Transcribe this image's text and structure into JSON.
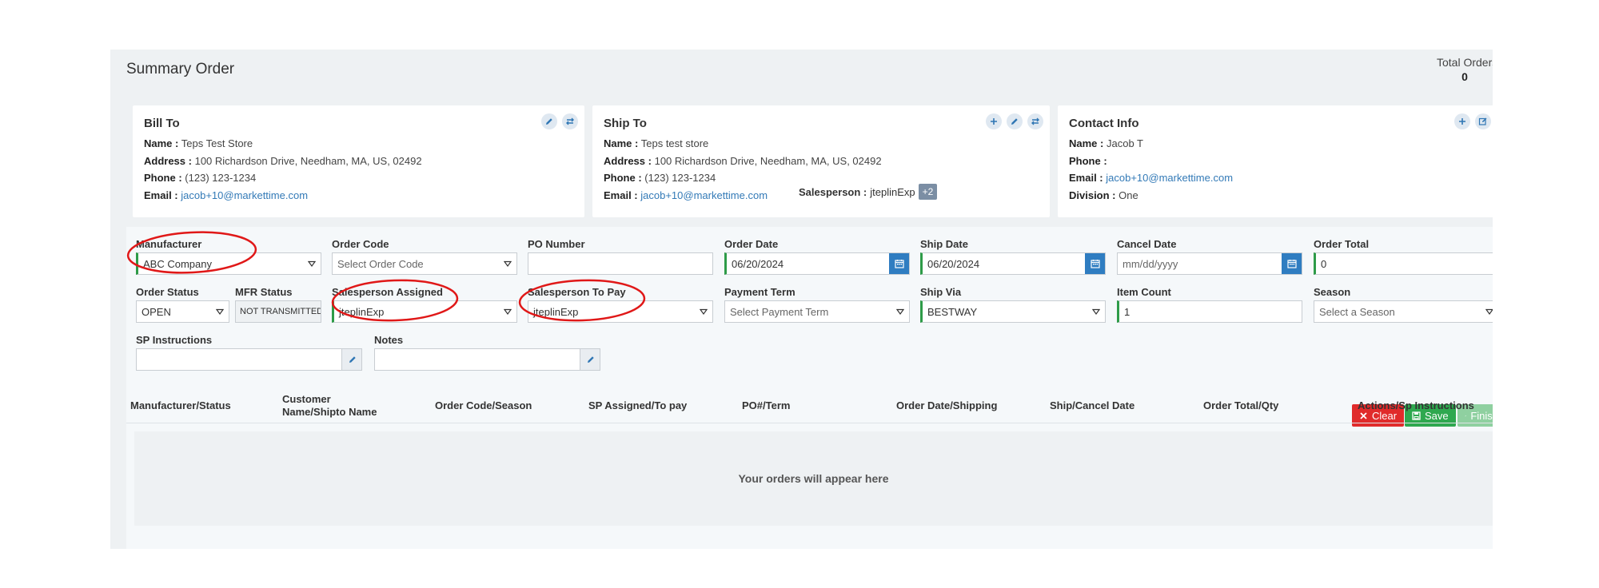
{
  "page": {
    "title": "Summary Order"
  },
  "total_orders": {
    "label": "Total Orders",
    "value": "0"
  },
  "bill_to": {
    "heading": "Bill To",
    "name_label": "Name :",
    "name": "Teps Test Store",
    "address_label": "Address :",
    "address": "100 Richardson Drive, Needham, MA, US, 02492",
    "phone_label": "Phone :",
    "phone": "(123) 123-1234",
    "email_label": "Email :",
    "email": "jacob+10@markettime.com"
  },
  "ship_to": {
    "heading": "Ship To",
    "name_label": "Name :",
    "name": "Teps test store",
    "address_label": "Address :",
    "address": "100 Richardson Drive, Needham, MA, US, 02492",
    "phone_label": "Phone :",
    "phone": "(123) 123-1234",
    "email_label": "Email :",
    "email": "jacob+10@markettime.com",
    "salesperson_label": "Salesperson :",
    "salesperson": "jteplinExp",
    "extra_badge": "+2"
  },
  "contact_info": {
    "heading": "Contact Info",
    "name_label": "Name :",
    "name": "Jacob T",
    "phone_label": "Phone :",
    "phone": "",
    "email_label": "Email :",
    "email": "jacob+10@markettime.com",
    "division_label": "Division :",
    "division": "One"
  },
  "form": {
    "manufacturer": {
      "label": "Manufacturer",
      "value": "ABC Company"
    },
    "order_code": {
      "label": "Order Code",
      "placeholder": "Select Order Code"
    },
    "po_number": {
      "label": "PO Number",
      "value": ""
    },
    "order_date": {
      "label": "Order Date",
      "value": "06/20/2024"
    },
    "ship_date": {
      "label": "Ship Date",
      "value": "06/20/2024"
    },
    "cancel_date": {
      "label": "Cancel Date",
      "placeholder": "mm/dd/yyyy"
    },
    "order_total": {
      "label": "Order Total",
      "value": "0"
    },
    "order_status": {
      "label": "Order Status",
      "value": "OPEN"
    },
    "mfr_status": {
      "label": "MFR Status",
      "value": "NOT TRANSMITTED"
    },
    "salesperson_assigned": {
      "label": "Salesperson Assigned",
      "value": "jteplinExp"
    },
    "salesperson_to_pay": {
      "label": "Salesperson To Pay",
      "value": "jteplinExp"
    },
    "payment_term": {
      "label": "Payment Term",
      "placeholder": "Select Payment Term"
    },
    "ship_via": {
      "label": "Ship Via",
      "value": "BESTWAY"
    },
    "item_count": {
      "label": "Item Count",
      "value": "1"
    },
    "season": {
      "label": "Season",
      "placeholder": "Select a Season"
    },
    "sp_instructions": {
      "label": "SP Instructions",
      "value": ""
    },
    "notes": {
      "label": "Notes",
      "value": ""
    }
  },
  "buttons": {
    "clear": "Clear",
    "save": "Save",
    "finish": "Finish"
  },
  "table": {
    "headers": [
      "Manufacturer/Status",
      "Customer Name/Shipto Name",
      "Order Code/Season",
      "SP Assigned/To pay",
      "PO#/Term",
      "Order Date/Shipping",
      "Ship/Cancel Date",
      "Order Total/Qty",
      "Actions/Sp Instructions"
    ],
    "empty_message": "Your orders will appear here"
  },
  "colors": {
    "accent_blue": "#2f7dc1",
    "required_green": "#2e9b48",
    "clear_red": "#e02b2b",
    "save_green": "#2ea84f",
    "annotation_red": "#e01818"
  },
  "icons": [
    "pencil-icon",
    "swap-icon",
    "plus-icon",
    "edit-square-icon",
    "calendar-icon",
    "caret-down-icon",
    "times-icon",
    "floppy-icon",
    "check-icon"
  ]
}
